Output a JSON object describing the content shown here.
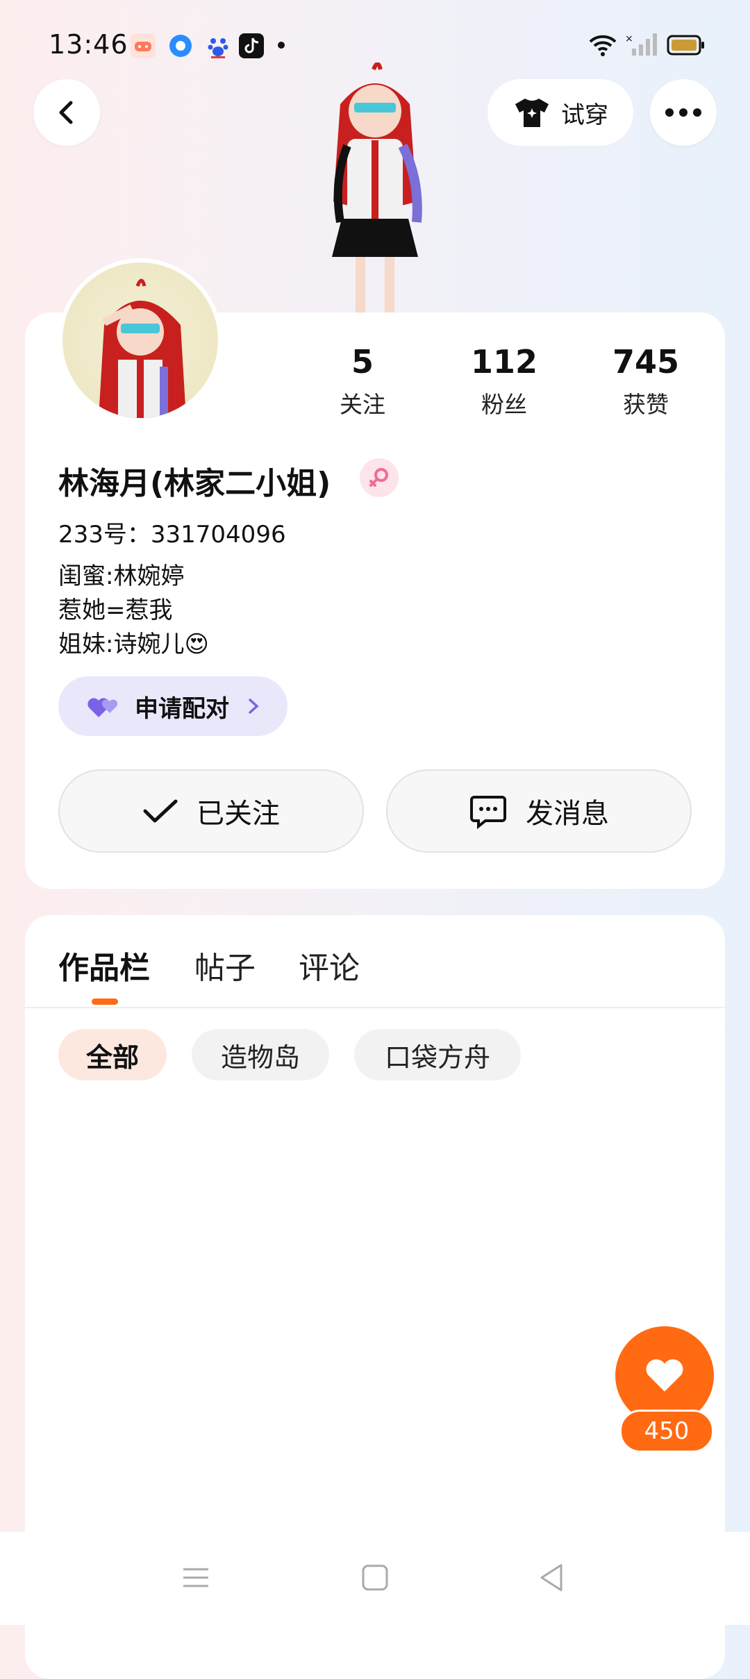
{
  "status_bar": {
    "time": "13:46"
  },
  "header": {
    "tryon_label": "试穿"
  },
  "profile": {
    "stats": [
      {
        "value": "5",
        "label": "关注"
      },
      {
        "value": "112",
        "label": "粉丝"
      },
      {
        "value": "745",
        "label": "获赞"
      }
    ],
    "name": "林海月(林家二小姐)",
    "id_line": "233号：331704096",
    "bio": [
      "闺蜜:林婉婷",
      "惹她=惹我",
      "姐妹:诗婉儿😍"
    ],
    "pair_label": "申请配对",
    "follow_label": "已关注",
    "message_label": "发消息"
  },
  "content": {
    "tabs": [
      "作品栏",
      "帖子",
      "评论"
    ],
    "chips": [
      "全部",
      "造物岛",
      "口袋方舟"
    ]
  },
  "like": {
    "count": "450"
  },
  "colors": {
    "accent": "#ff6a12",
    "pair_bg": "#e9e8fb",
    "pair_heart": "#7b61e8"
  }
}
